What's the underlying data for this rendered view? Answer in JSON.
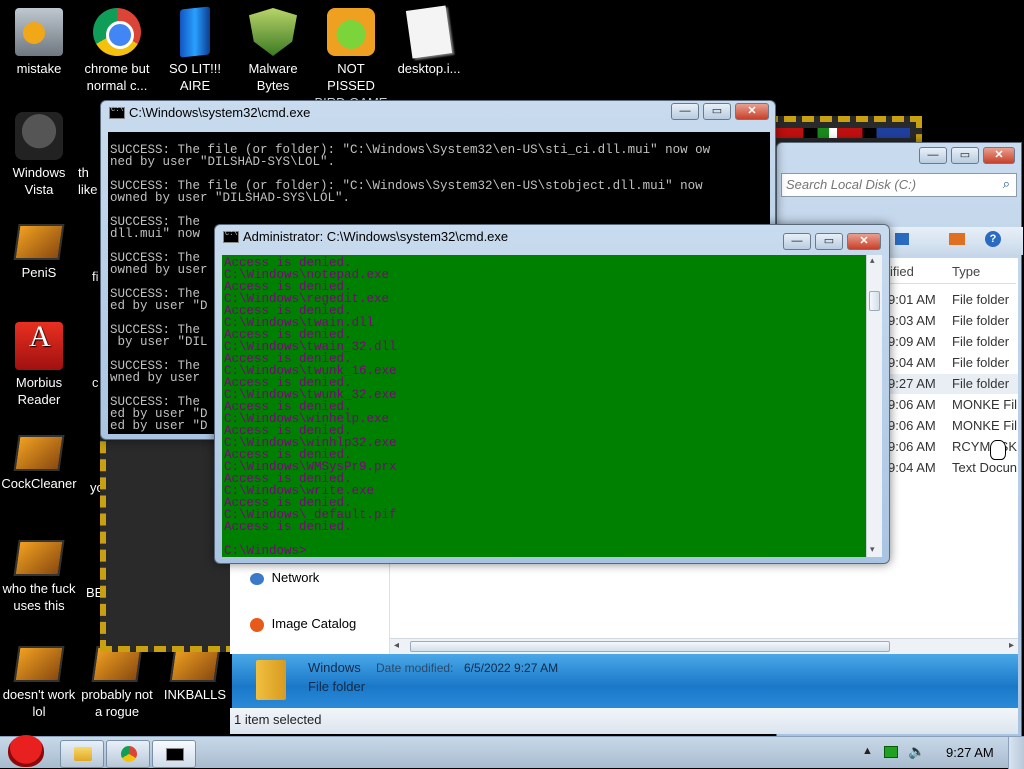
{
  "desktop_icons": [
    {
      "label": "mistake",
      "icon": "folder-drive-icon"
    },
    {
      "label": "chrome but normal c...",
      "icon": "chrome-icon"
    },
    {
      "label": "SO LIT!!! AIRE",
      "icon": "blue-bar-icon"
    },
    {
      "label": "Malware Bytes",
      "icon": "shield-check-icon"
    },
    {
      "label": "NOT PISSED BIRD GAME",
      "icon": "green-pig-icon"
    },
    {
      "label": "desktop.i...",
      "icon": "paper-icon"
    },
    {
      "label": "Windows Vista",
      "icon": "recycle-bin-icon"
    },
    {
      "label": "PeniS",
      "icon": "laptop-icon"
    },
    {
      "label": "Morbius Reader",
      "icon": "adobe-reader-icon"
    },
    {
      "label": "CockCleaner",
      "icon": "laptop-icon"
    },
    {
      "label": "who the fuck uses this",
      "icon": "laptop-icon"
    },
    {
      "label": "doesn't work lol",
      "icon": "laptop-icon"
    },
    {
      "label": "probably not a rogue",
      "icon": "laptop-icon"
    },
    {
      "label": "INKBALLS",
      "icon": "laptop-icon"
    }
  ],
  "partial_icon_labels": [
    "th",
    "like",
    "fi",
    "c",
    "yo",
    "BE"
  ],
  "cmd_back": {
    "title": "C:\\Windows\\system32\\cmd.exe",
    "lines": [
      "SUCCESS: The file (or folder): \"C:\\Windows\\System32\\en-US\\sti_ci.dll.mui\" now ow",
      "ned by user \"DILSHAD-SYS\\LOL\".",
      "",
      "SUCCESS: The file (or folder): \"C:\\Windows\\System32\\en-US\\stobject.dll.mui\" now",
      "owned by user \"DILSHAD-SYS\\LOL\".",
      "",
      "SUCCESS: The",
      "dll.mui\" now",
      "",
      "SUCCESS: The",
      "owned by user",
      "",
      "SUCCESS: The",
      "ed by user \"D",
      "",
      "SUCCESS: The",
      " by user \"DIL",
      "",
      "SUCCESS: The",
      "wned by user",
      "",
      "SUCCESS: The",
      "ed by user \"D",
      "ed by user \"D"
    ]
  },
  "cmd_front": {
    "title": "Administrator: C:\\Windows\\system32\\cmd.exe",
    "lines": [
      "Access is denied.",
      "C:\\Windows\\notepad.exe",
      "Access is denied.",
      "C:\\Windows\\regedit.exe",
      "Access is denied.",
      "C:\\Windows\\twain.dll",
      "Access is denied.",
      "C:\\Windows\\twain_32.dll",
      "Access is denied.",
      "C:\\Windows\\twunk_16.exe",
      "Access is denied.",
      "C:\\Windows\\twunk_32.exe",
      "Access is denied.",
      "C:\\Windows\\winhelp.exe",
      "Access is denied.",
      "C:\\Windows\\winhlp32.exe",
      "Access is denied.",
      "C:\\Windows\\WMSysPr9.prx",
      "Access is denied.",
      "C:\\Windows\\write.exe",
      "Access is denied.",
      "C:\\Windows\\_default.pif",
      "Access is denied.",
      "",
      "C:\\Windows>"
    ]
  },
  "explorer": {
    "search_placeholder": "Search Local Disk (C:)",
    "col_modified": "ified",
    "col_type": "Type",
    "rows": [
      {
        "time": "9:01 AM",
        "type": "File folder"
      },
      {
        "time": "9:03 AM",
        "type": "File folder"
      },
      {
        "time": "9:09 AM",
        "type": "File folder"
      },
      {
        "time": "9:04 AM",
        "type": "File folder"
      },
      {
        "time": "9:27 AM",
        "type": "File folder"
      },
      {
        "time": "9:06 AM",
        "type": "MONKE Fil"
      },
      {
        "time": "9:06 AM",
        "type": "MONKE Fil"
      },
      {
        "time": "9:06 AM",
        "type": "RCYMCSK"
      },
      {
        "time": "9:04 AM",
        "type": "Text Docun"
      }
    ],
    "nav_network": "Network",
    "nav_image_catalog": "Image Catalog",
    "details_name": "Windows",
    "details_date_label": "Date modified:",
    "details_date_value": "6/5/2022 9:27 AM",
    "details_type": "File folder",
    "status": "1 item selected"
  },
  "taskbar": {
    "clock": "9:27 AM"
  },
  "colors": {
    "console_green_bg": "#008000",
    "console_magenta_text": "#800080",
    "console_black_bg": "#000000"
  }
}
